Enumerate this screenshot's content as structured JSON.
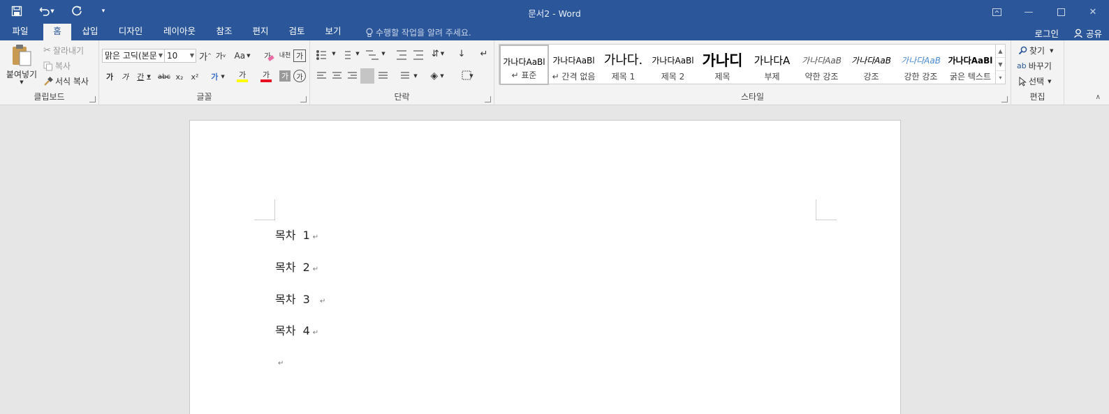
{
  "window": {
    "title": "문서2 - Word"
  },
  "tabs": [
    {
      "label": "파일"
    },
    {
      "label": "홈"
    },
    {
      "label": "삽입"
    },
    {
      "label": "디자인"
    },
    {
      "label": "레이아웃"
    },
    {
      "label": "참조"
    },
    {
      "label": "편지"
    },
    {
      "label": "검토"
    },
    {
      "label": "보기"
    }
  ],
  "tell_me": "수행할 작업을 알려 주세요.",
  "account": {
    "login": "로그인",
    "share": "공유"
  },
  "clipboard": {
    "paste": "붙여넣기",
    "cut": "잘라내기",
    "copy": "복사",
    "format_painter": "서식 복사",
    "label": "클립보드"
  },
  "font": {
    "name": "맑은 고딕(본문",
    "size": "10",
    "grow": "가",
    "shrink": "가",
    "case": "Aa",
    "clear": "가",
    "phonetic": "내천",
    "border": "가",
    "bold": "가",
    "italic": "가",
    "underline": "간",
    "strike": "abc",
    "sub": "x₂",
    "sup": "x²",
    "effects": "가",
    "highlight": "가",
    "color": "가",
    "shade": "가",
    "enclose": "가",
    "label": "글꼴"
  },
  "paragraph": {
    "label": "단락"
  },
  "styles": {
    "label": "스타일",
    "items": [
      {
        "preview": "가나다AaBl",
        "name": "↵ 표준"
      },
      {
        "preview": "가나다AaBl",
        "name": "↵ 간격 없음"
      },
      {
        "preview": "가나다.",
        "name": "제목 1"
      },
      {
        "preview": "가나다AaBl",
        "name": "제목 2"
      },
      {
        "preview": "가나디",
        "name": "제목"
      },
      {
        "preview": "가나다A",
        "name": "부제"
      },
      {
        "preview": "가나다AaB",
        "name": "약한 강조"
      },
      {
        "preview": "가나다AaB",
        "name": "강조"
      },
      {
        "preview": "가나다AaB",
        "name": "강한 강조"
      },
      {
        "preview": "가나다AaBl",
        "name": "굵은 텍스트"
      }
    ]
  },
  "editing": {
    "find": "찾기",
    "replace": "바꾸기",
    "select": "선택",
    "label": "편집"
  },
  "document": {
    "paragraphs": [
      {
        "text": "목차  1",
        "mark": "↵"
      },
      {
        "text": "목차  2",
        "mark": "↵"
      },
      {
        "text": "목차  3  ",
        "mark": "↵"
      },
      {
        "text": "목차  4",
        "mark": "↵"
      },
      {
        "text": "",
        "mark": "↵"
      }
    ]
  },
  "colors": {
    "brand": "#2b579a",
    "ribbon": "#f3f3f3",
    "canvas": "#e6e6e6",
    "highlight": "#ffff00",
    "font_color": "#e81123"
  }
}
